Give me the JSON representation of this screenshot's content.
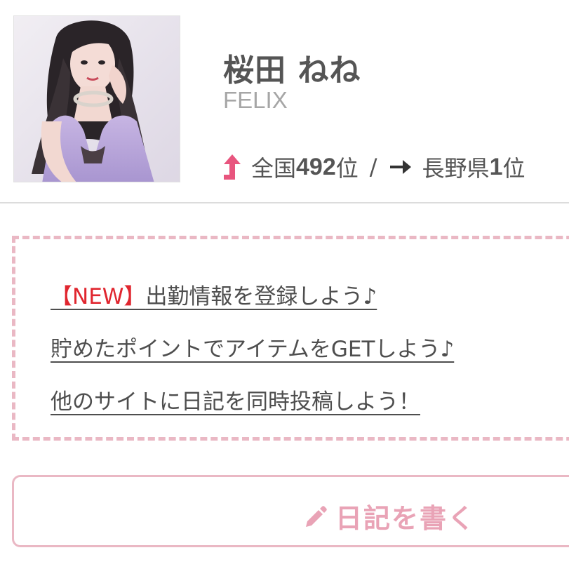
{
  "profile": {
    "name": "桜田 ねね",
    "shop": "FELIX",
    "avatar_icon": "profile-photo",
    "rank": {
      "national_trend_icon": "arrow-up-icon",
      "national_label": "全国",
      "national_rank": "492",
      "national_suffix": "位",
      "separator": "/",
      "prefecture_trend_icon": "arrow-right-icon",
      "prefecture_label": "長野県",
      "prefecture_rank": "1",
      "prefecture_suffix": "位"
    }
  },
  "notice": {
    "links": [
      {
        "tag": "【NEW】",
        "text": "出勤情報を登録しよう♪"
      },
      {
        "tag": "",
        "text": "貯めたポイントでアイテムをGETしよう♪"
      },
      {
        "tag": "",
        "text": "他のサイトに日記を同時投稿しよう！"
      }
    ]
  },
  "write_button": {
    "icon": "pencil-icon",
    "label": "日記を書く"
  },
  "colors": {
    "accent_pink": "#eab8c4",
    "button_text_pink": "#e9a3b6",
    "arrow_up_pink": "#e8557e",
    "new_tag_red": "#e0262f",
    "text_dark": "#555555",
    "text_muted": "#a6a6a6",
    "divider": "#dcdcdc"
  }
}
